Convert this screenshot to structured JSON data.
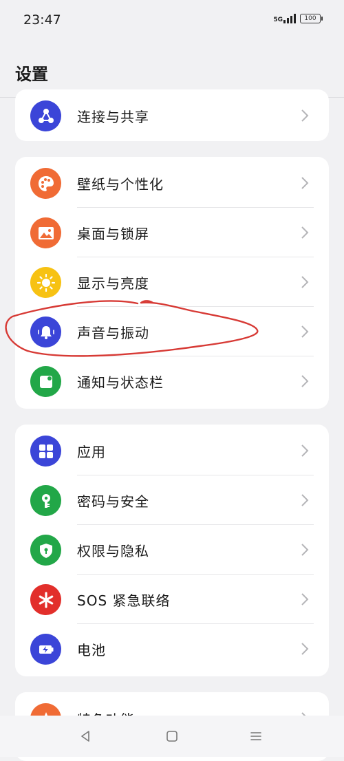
{
  "status_bar": {
    "time": "23:47",
    "network": "5G",
    "battery": "100"
  },
  "header": {
    "title": "设置"
  },
  "groups": [
    {
      "items": [
        {
          "label": "连接与共享",
          "icon": "share-icon",
          "color": "#3b45d8"
        }
      ]
    },
    {
      "items": [
        {
          "label": "壁纸与个性化",
          "icon": "palette-icon",
          "color": "#f06b35"
        },
        {
          "label": "桌面与锁屏",
          "icon": "image-icon",
          "color": "#f06b35"
        },
        {
          "label": "显示与亮度",
          "icon": "sun-icon",
          "color": "#f7c213"
        },
        {
          "label": "声音与振动",
          "icon": "bell-icon",
          "color": "#3b45d8"
        },
        {
          "label": "通知与状态栏",
          "icon": "notification-icon",
          "color": "#22a748"
        }
      ]
    },
    {
      "items": [
        {
          "label": "应用",
          "icon": "apps-grid-icon",
          "color": "#3b45d8"
        },
        {
          "label": "密码与安全",
          "icon": "key-icon",
          "color": "#22a748"
        },
        {
          "label": "权限与隐私",
          "icon": "shield-lock-icon",
          "color": "#22a748"
        },
        {
          "label": "SOS 紧急联络",
          "icon": "asterisk-icon",
          "color": "#e22f2b"
        },
        {
          "label": "电池",
          "icon": "battery-charge-icon",
          "color": "#3b45d8"
        }
      ]
    },
    {
      "items": [
        {
          "label": "特色功能",
          "icon": "star-icon",
          "color": "#f06b35"
        }
      ]
    }
  ],
  "nav": {
    "back": "back-icon",
    "home": "home-icon",
    "recents": "recents-icon"
  },
  "annotation": {
    "color": "#d73a35"
  }
}
